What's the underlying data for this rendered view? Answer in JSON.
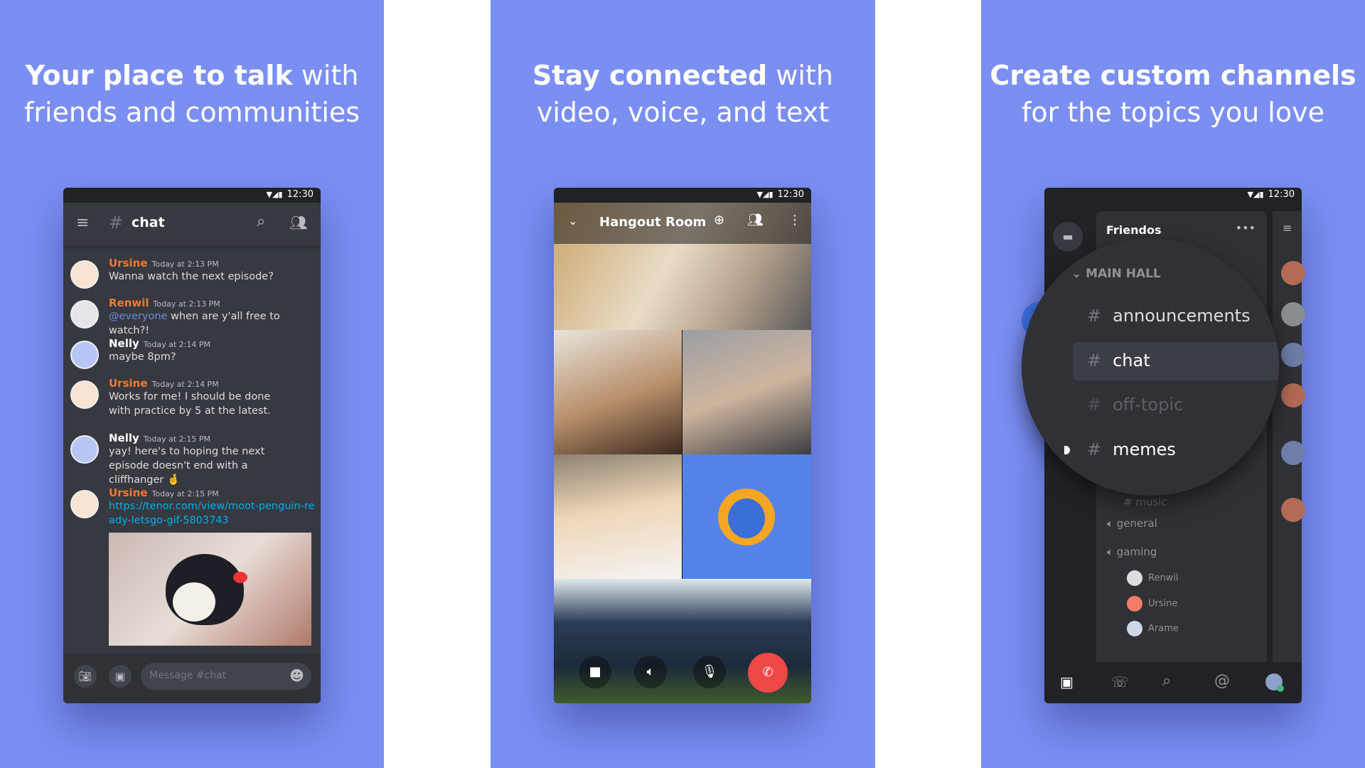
{
  "colors": {
    "background": "#7b8ff2",
    "discord_dark": "#36393f",
    "username_orange": "#f57731",
    "mention": "#7289da",
    "link": "#00b0f4",
    "end_call": "#f04747"
  },
  "panels": [
    {
      "headline_bold": "Your place to talk",
      "headline_rest": " with",
      "headline_line2": "friends and communities"
    },
    {
      "headline_bold": "Stay connected",
      "headline_rest": " with",
      "headline_line2": "video, voice, and text"
    },
    {
      "headline_bold": "Create custom channels",
      "headline_rest": "",
      "headline_line2": "for the topics you love"
    }
  ],
  "status_time": "12:30",
  "chat_phone": {
    "channel": "chat",
    "icons": [
      "menu-icon",
      "hash-icon",
      "search-icon",
      "members-icon",
      "camera-icon",
      "gallery-icon",
      "emoji-icon"
    ],
    "messages": [
      {
        "author": "Ursine",
        "time": "Today at 2:13 PM",
        "text": "Wanna watch the next episode?"
      },
      {
        "author": "Renwil",
        "time": "Today at 2:13 PM",
        "mention": "@everyone",
        "text": " when are y'all free to watch?!"
      },
      {
        "author": "Nelly",
        "time": "Today at 2:14 PM",
        "text": "maybe 8pm?"
      },
      {
        "author": "Ursine",
        "time": "Today at 2:14 PM",
        "text": "Works for me! I should be done with practice by 5 at the latest."
      },
      {
        "author": "Nelly",
        "time": "Today at 2:15 PM",
        "text": "yay! here's to hoping the next episode doesn't end with a cliffhanger 🤞"
      },
      {
        "author": "Ursine",
        "time": "Today at 2:15 PM",
        "link": "https://tenor.com/view/moot-penguin-ready-letsgo-gif-5803743"
      }
    ],
    "input_placeholder": "Message #chat"
  },
  "video_phone": {
    "room": "Hangout Room"
  },
  "channels_phone": {
    "server": "Friendos",
    "category": "MAIN HALL",
    "text_channels": [
      "announcements",
      "chat",
      "off-topic",
      "memes",
      "music"
    ],
    "selected": "chat",
    "voice_channels": [
      "general",
      "gaming"
    ],
    "voice_users": [
      "Renwil",
      "Ursine",
      "Arame"
    ]
  }
}
